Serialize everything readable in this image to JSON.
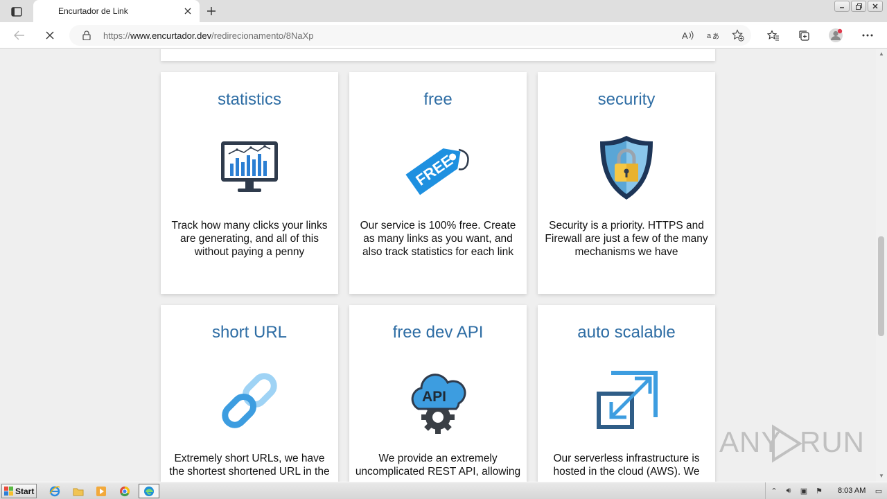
{
  "browser": {
    "tab_title": "Encurtador de Link",
    "url_prefix": "https://",
    "url_host": "www.encurtador.dev",
    "url_path": "/redirecionamento/8NaXp",
    "icons": [
      "tab-actions-icon",
      "close-icon",
      "plus-icon",
      "back-icon",
      "stop-icon",
      "lock-icon",
      "read-aloud-icon",
      "translate-icon",
      "add-favorite-icon",
      "favorites-icon",
      "collections-icon",
      "profile-icon",
      "more-icon"
    ]
  },
  "features": [
    {
      "title": "statistics",
      "text": "Track how many clicks your links are generating, and all of this without paying a penny",
      "icon": "monitor-chart-icon"
    },
    {
      "title": "free",
      "text": "Our service is 100% free. Create as many links as you want, and also track statistics for each link",
      "icon": "free-tag-icon",
      "tag_text": "FREE"
    },
    {
      "title": "security",
      "text": "Security is a priority. HTTPS and Firewall are just a few of the many mechanisms we have",
      "icon": "shield-lock-icon"
    },
    {
      "title": "short URL",
      "text": "Extremely short URLs, we have the shortest shortened URL in the",
      "icon": "chain-link-icon"
    },
    {
      "title": "free dev API",
      "text": "We provide an extremely uncomplicated REST API, allowing",
      "icon": "cloud-api-icon",
      "badge_text": "API"
    },
    {
      "title": "auto scalable",
      "text": "Our serverless infrastructure is hosted in the cloud (AWS). We",
      "icon": "expand-arrows-icon"
    }
  ],
  "watermark": {
    "left": "ANY",
    "right": "RUN"
  },
  "taskbar": {
    "start_label": "Start",
    "clock": "8:03 AM"
  },
  "colors": {
    "accent": "#2e6da4",
    "free_tag": "#1e90e0",
    "shield": "#1d3557"
  }
}
